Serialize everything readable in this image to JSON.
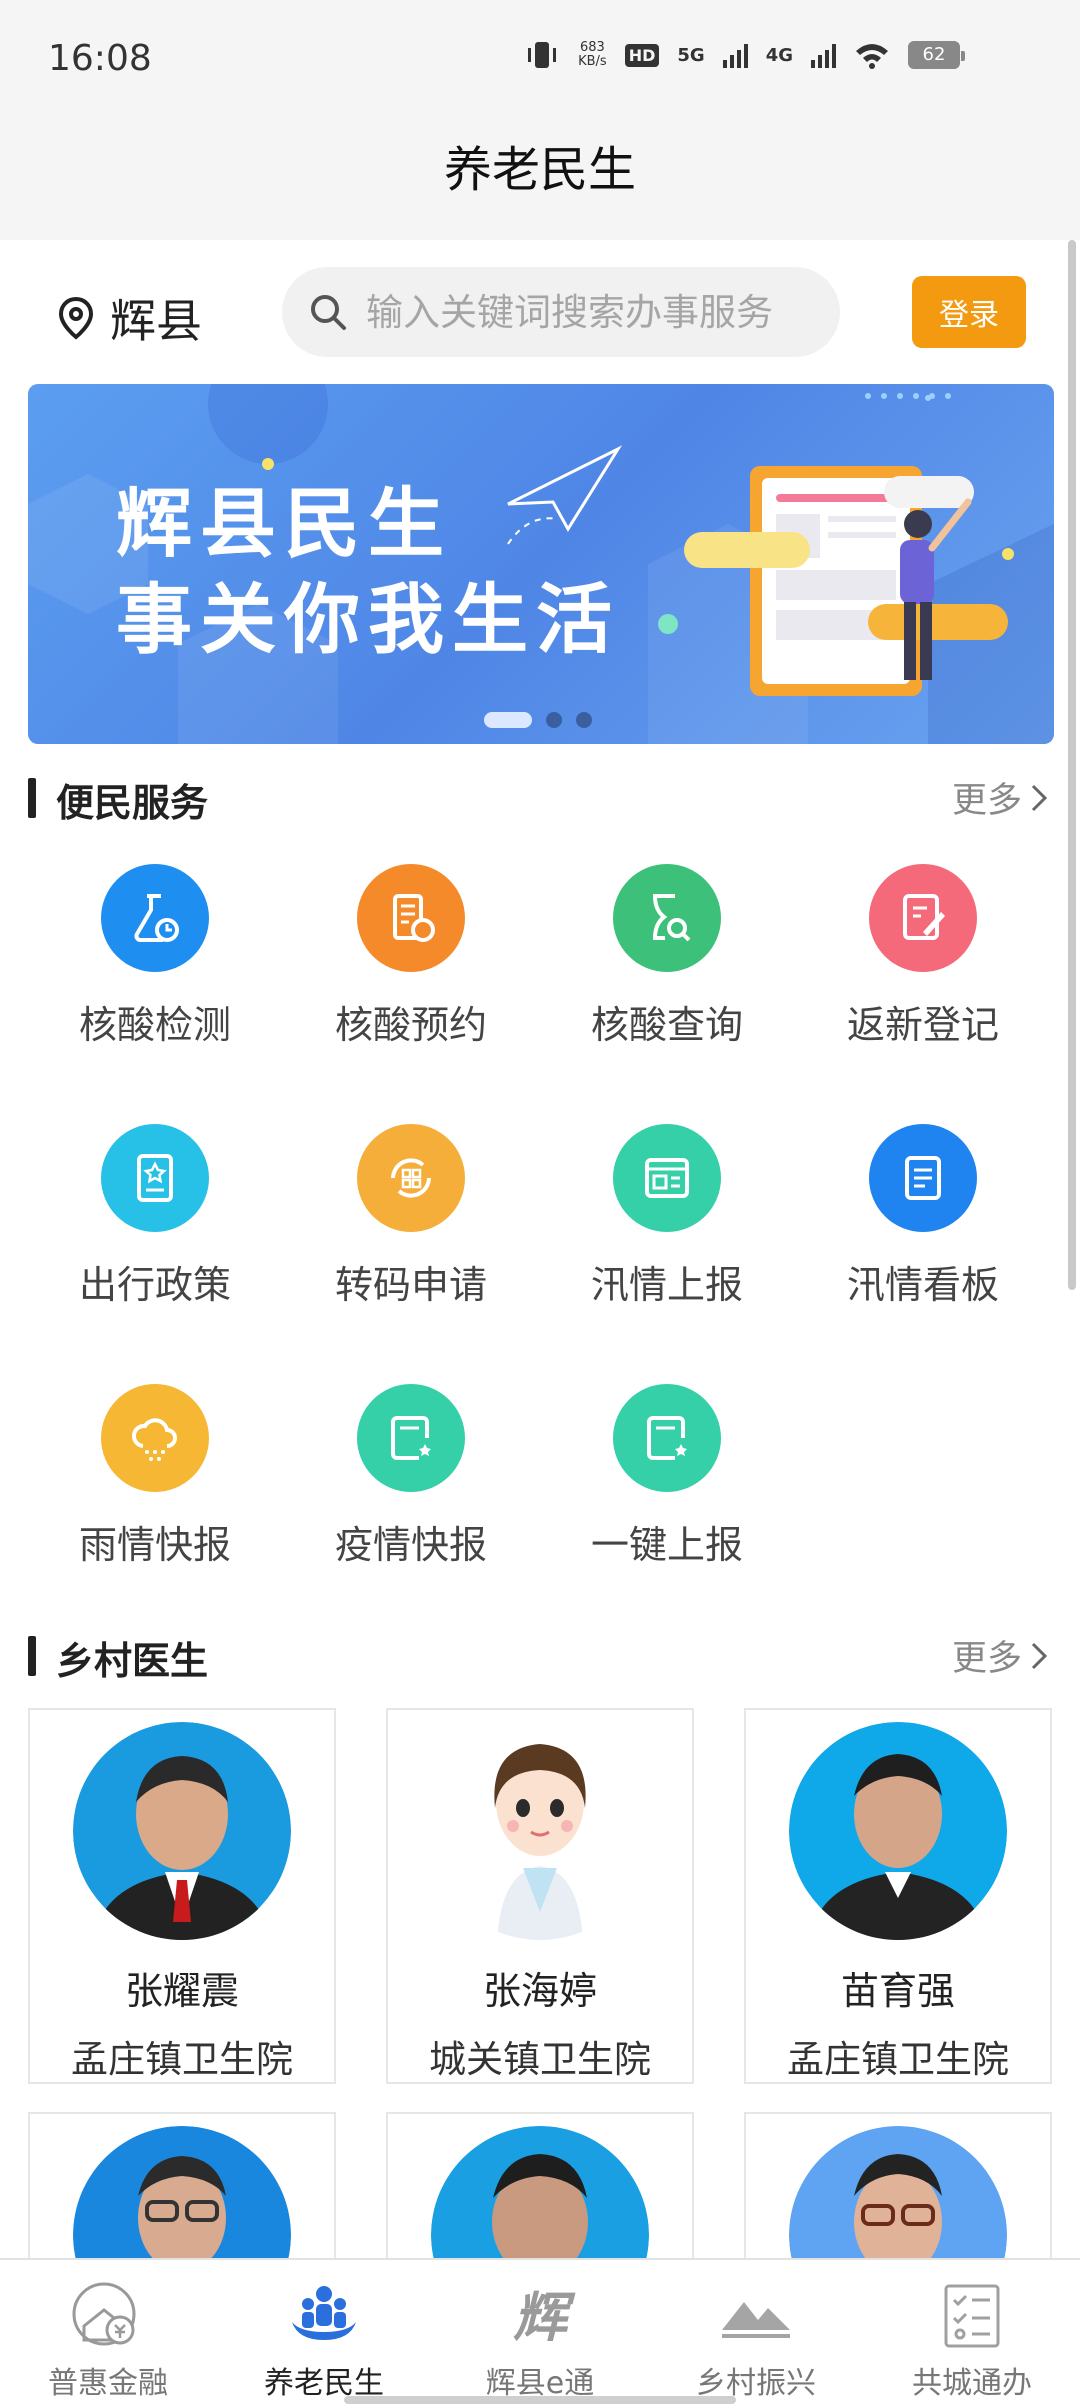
{
  "status_bar": {
    "time": "16:08",
    "net_speed_value": "683",
    "net_speed_unit": "KB/s",
    "hd_badge": "HD",
    "signal_1": "5G",
    "signal_2": "4G",
    "battery": "62"
  },
  "header": {
    "title": "养老民生"
  },
  "location": {
    "city": "辉县",
    "icon": "location-pin-icon"
  },
  "search": {
    "placeholder": "输入关键词搜索办事服务",
    "icon": "search-icon"
  },
  "login_button": "登录",
  "banner": {
    "line1": "辉县民生",
    "line2": "事关你我生活",
    "dots_total": 3,
    "dot_active": 1
  },
  "services": {
    "title": "便民服务",
    "more": "更多",
    "items": [
      {
        "label": "核酸检测",
        "icon": "lab-flask-icon",
        "color": "#1e90f0"
      },
      {
        "label": "核酸预约",
        "icon": "building-clock-icon",
        "color": "#f58a2a"
      },
      {
        "label": "核酸查询",
        "icon": "hourglass-search-icon",
        "color": "#3cc07a"
      },
      {
        "label": "返新登记",
        "icon": "edit-note-icon",
        "color": "#f46a7a"
      },
      {
        "label": "出行政策",
        "icon": "policy-document-icon",
        "color": "#27c0e6"
      },
      {
        "label": "转码申请",
        "icon": "code-switch-icon",
        "color": "#f6ae3a"
      },
      {
        "label": "汛情上报",
        "icon": "news-window-icon",
        "color": "#35d0a8"
      },
      {
        "label": "汛情看板",
        "icon": "board-document-icon",
        "color": "#1f84ef"
      },
      {
        "label": "雨情快报",
        "icon": "rain-cloud-icon",
        "color": "#f6b735"
      },
      {
        "label": "疫情快报",
        "icon": "report-star-icon",
        "color": "#35d0a8"
      },
      {
        "label": "一键上报",
        "icon": "report-star-icon",
        "color": "#35d0a8"
      }
    ]
  },
  "doctors": {
    "title": "乡村医生",
    "more": "更多",
    "items": [
      {
        "name": "张耀震",
        "org": "孟庄镇卫生院"
      },
      {
        "name": "张海婷",
        "org": "城关镇卫生院"
      },
      {
        "name": "苗育强",
        "org": "孟庄镇卫生院"
      }
    ]
  },
  "bottom_nav": {
    "items": [
      {
        "label": "普惠金融",
        "icon": "finance-coin-icon"
      },
      {
        "label": "养老民生",
        "icon": "people-hands-icon",
        "active": true
      },
      {
        "label": "辉县e通",
        "icon": "hui-logo-icon"
      },
      {
        "label": "乡村振兴",
        "icon": "mountains-icon"
      },
      {
        "label": "共城通办",
        "icon": "checklist-icon"
      }
    ]
  }
}
